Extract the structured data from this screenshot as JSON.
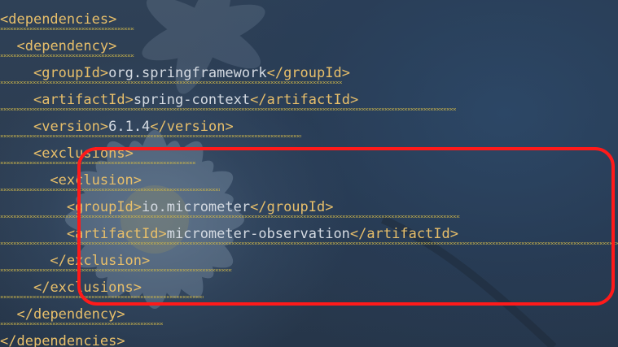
{
  "editor": {
    "lines": [
      {
        "open": "<",
        "tag": "dependencies",
        "close": ">",
        "text": "",
        "end_open": "",
        "end_tag": "",
        "end_close": ""
      },
      {
        "open": "<",
        "tag": "dependency",
        "close": ">",
        "text": "",
        "end_open": "",
        "end_tag": "",
        "end_close": ""
      },
      {
        "open": "<",
        "tag": "groupId",
        "close": ">",
        "text": "org.springframework",
        "end_open": "</",
        "end_tag": "groupId",
        "end_close": ">"
      },
      {
        "open": "<",
        "tag": "artifactId",
        "close": ">",
        "text": "spring-context",
        "end_open": "</",
        "end_tag": "artifactId",
        "end_close": ">"
      },
      {
        "open": "<",
        "tag": "version",
        "close": ">",
        "text": "6.1.4",
        "end_open": "</",
        "end_tag": "version",
        "end_close": ">"
      },
      {
        "open": "<",
        "tag": "exclusions",
        "close": ">",
        "text": "",
        "end_open": "",
        "end_tag": "",
        "end_close": ""
      },
      {
        "open": "<",
        "tag": "exclusion",
        "close": ">",
        "text": "",
        "end_open": "",
        "end_tag": "",
        "end_close": ""
      },
      {
        "open": "<",
        "tag": "groupId",
        "close": ">",
        "text": "io.micrometer",
        "end_open": "</",
        "end_tag": "groupId",
        "end_close": ">"
      },
      {
        "open": "<",
        "tag": "artifactId",
        "close": ">",
        "text": "micrometer-observation",
        "end_open": "</",
        "end_tag": "artifactId",
        "end_close": ">"
      },
      {
        "open": "</",
        "tag": "exclusion",
        "close": ">",
        "text": "",
        "end_open": "",
        "end_tag": "",
        "end_close": ""
      },
      {
        "open": "</",
        "tag": "exclusions",
        "close": ">",
        "text": "",
        "end_open": "",
        "end_tag": "",
        "end_close": ""
      },
      {
        "open": "</",
        "tag": "dependency",
        "close": ">",
        "text": "",
        "end_open": "",
        "end_tag": "",
        "end_close": ""
      },
      {
        "open": "</",
        "tag": "dependencies",
        "close": ">",
        "text": "",
        "end_open": "",
        "end_tag": "",
        "end_close": ""
      }
    ]
  },
  "colors": {
    "tag": "#e8bf6a",
    "text": "#d4dae2",
    "highlight_border": "#ff1a1a",
    "warning_squiggle": "#c9b24a",
    "background": "#2b3b4f"
  }
}
